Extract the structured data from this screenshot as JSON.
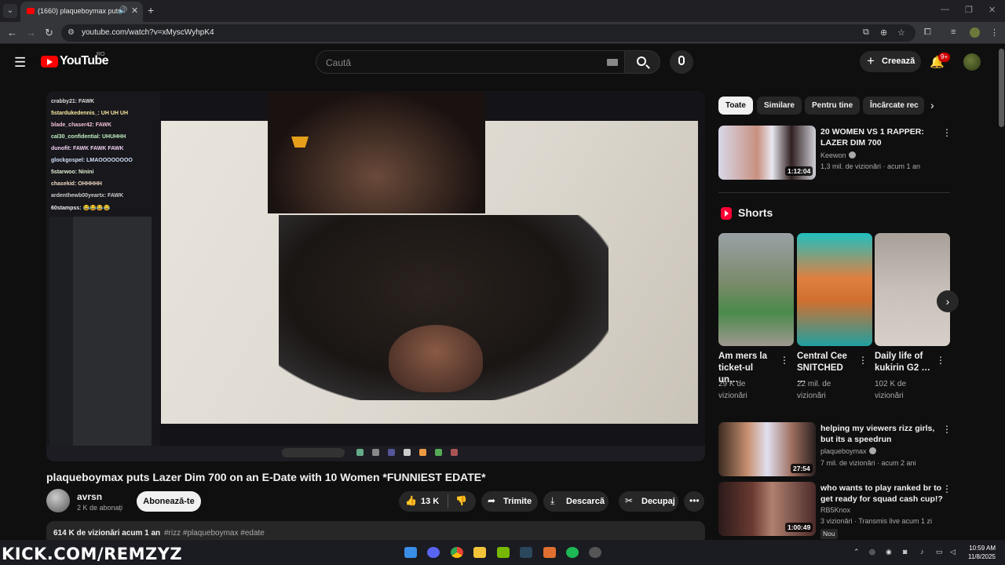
{
  "browser": {
    "tab_title": "(1660) plaqueboymax puts",
    "url": "youtube.com/watch?v=xMyscWyhpK4"
  },
  "header": {
    "logo_text": "YouTube",
    "country": "RO",
    "search_placeholder": "Caută",
    "create_label": "Creează",
    "notifications_badge": "9+"
  },
  "video": {
    "title": "plaqueboymax puts Lazer Dim 700 on an E-Date with 10 Women *FUNNIEST EDATE*",
    "channel": "avrsn",
    "subscribers": "2 K de abonați",
    "subscribe_label": "Abonează-te",
    "likes": "13 K",
    "share_label": "Trimite",
    "download_label": "Descarcă",
    "clip_label": "Decupaj",
    "views_age": "614 K de vizionări  acum 1 an",
    "hashtags": "#rizz #plaqueboymax #edate",
    "chat_lines": [
      "crabby21: FAWK",
      "5stardukedennis_: UH UH UH",
      "blade_chaser42: FAWK",
      "cal30_confidential: UHUHHH",
      "dunofit: FAWK FAWK FAWK",
      "glockgospel: LMAOOOOOOOO",
      "5starwoo: Ninini",
      "chasekid: OHHHHH",
      "ardenthewb00yeartx: FAWK",
      "60stampss: 😂😂😂😂"
    ]
  },
  "chips": [
    "Toate",
    "Similare",
    "Pentru tine",
    "Încărcate rec"
  ],
  "related": [
    {
      "title": "20 WOMEN VS 1 RAPPER: LAZER DIM 700",
      "channel": "Keewon",
      "meta": "1,3 mil. de vizionări · acum 1 an",
      "duration": "1:12:04"
    },
    {
      "title": "helping my viewers rizz girls, but its a speedrun",
      "channel": "plaqueboymax",
      "meta": "7 mil. de vizionări · acum 2 ani",
      "duration": "27:54"
    },
    {
      "title": "who wants to play ranked br to get ready for squad cash cup!?",
      "channel": "RB5Knox",
      "meta": "3 vizionări · Transmis live acum 1 zi",
      "duration": "1:00:49",
      "badge": "Nou"
    }
  ],
  "shorts": {
    "heading": "Shorts",
    "items": [
      {
        "title": "Am mers la ticket-ul un…",
        "views": "29 K de vizionări"
      },
      {
        "title": "Central Cee SNITCHED …",
        "views": "22 mil. de vizionări"
      },
      {
        "title": "Daily life of kukirin G2 …",
        "views": "102 K de vizionări"
      }
    ]
  },
  "overlay": {
    "kick": "KICK.COM/REMZYZ"
  },
  "clock": {
    "time": "10:59 AM",
    "date": "11/8/2025"
  },
  "colors": {
    "accent": "#ff0000",
    "background": "#0f0f0f",
    "chip_active": "#f1f1f1"
  }
}
